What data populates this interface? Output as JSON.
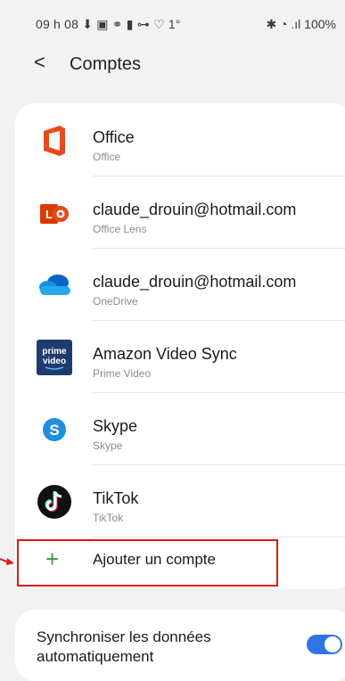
{
  "status_bar": {
    "left_text": "09 h 08 ⬇ ▣ ⚭ ▮ ⊶ ♡ 1°",
    "right_text": "✱ ◔ .ıl 100%"
  },
  "header": {
    "back_glyph": "<",
    "title": "Comptes"
  },
  "accounts": [
    {
      "name": "Office",
      "app": "Office",
      "icon": "office-icon"
    },
    {
      "name": "claude_drouin@hotmail.com",
      "app": "Office Lens",
      "icon": "office-lens-icon"
    },
    {
      "name": "claude_drouin@hotmail.com",
      "app": "OneDrive",
      "icon": "onedrive-icon"
    },
    {
      "name": "Amazon Video Sync",
      "app": "Prime Video",
      "icon": "prime-video-icon"
    },
    {
      "name": "Skype",
      "app": "Skype",
      "icon": "skype-icon"
    },
    {
      "name": "TikTok",
      "app": "TikTok",
      "icon": "tiktok-icon"
    }
  ],
  "add_account": {
    "plus": "+",
    "label": "Ajouter un compte"
  },
  "sync": {
    "label": "Synchroniser les données automatiquement",
    "enabled": true
  },
  "prime_icon_text": {
    "line1": "prime",
    "line2": "video"
  },
  "colors": {
    "office": "#e8491d",
    "onedrive": "#0a64c7",
    "prime": "#1f3b6d",
    "skype": "#1e8fdc",
    "tiktok": "#111111",
    "add_plus": "#3c9a3f",
    "highlight": "#e0161b",
    "toggle": "#2f74e6"
  }
}
